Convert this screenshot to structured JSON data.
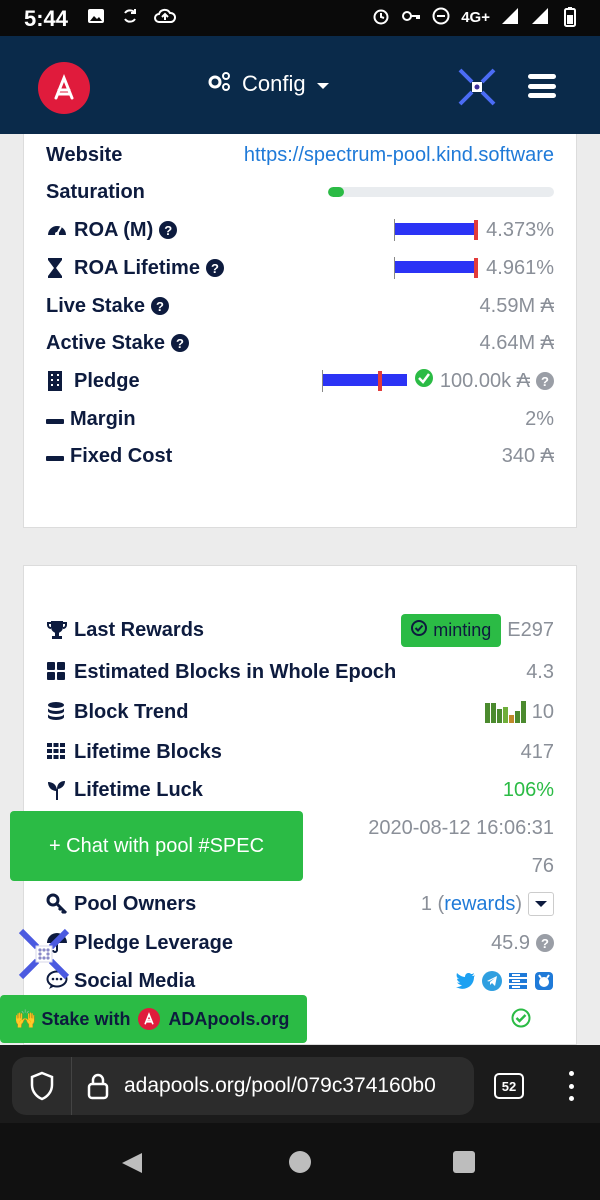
{
  "status_bar": {
    "time": "5:44",
    "network": "4G+"
  },
  "header": {
    "config_label": "Config"
  },
  "pool_params": {
    "website_label": "Website",
    "website_value": "https://spectrum-pool.kind.software",
    "saturation_label": "Saturation",
    "saturation_fraction": 0.07,
    "roa_m_label": "ROA (M)",
    "roa_m_value": "4.373%",
    "roa_lifetime_label": "ROA Lifetime",
    "roa_lifetime_value": "4.961%",
    "live_stake_label": "Live Stake",
    "live_stake_value": "4.59M ₳",
    "active_stake_label": "Active Stake",
    "active_stake_value": "4.64M ₳",
    "pledge_label": "Pledge",
    "pledge_value": "100.00k ₳",
    "margin_label": "Margin",
    "margin_value": "2%",
    "fixed_cost_label": "Fixed Cost",
    "fixed_cost_value": "340 ₳"
  },
  "pool_stats": {
    "last_rewards_label": "Last Rewards",
    "minting_badge": "minting",
    "last_rewards_epoch": "E297",
    "estimated_blocks_label": "Estimated Blocks in Whole Epoch",
    "estimated_blocks_value": "4.3",
    "block_trend_label": "Block Trend",
    "block_trend_value": "10",
    "lifetime_blocks_label": "Lifetime Blocks",
    "lifetime_blocks_value": "417",
    "lifetime_luck_label": "Lifetime Luck",
    "lifetime_luck_value": "106%",
    "registered_value": "2020-08-12 16:06:31",
    "hidden_row_value": "76",
    "pool_owners_label": "Pool Owners",
    "pool_owners_count": "1 (",
    "pool_owners_rewards": "rewards",
    "pool_owners_close": ")",
    "pledge_leverage_label": "Pledge Leverage",
    "pledge_leverage_value": "45.9",
    "social_media_label": "Social Media"
  },
  "floating": {
    "chat_button": "+ Chat with pool #SPEC",
    "stake_button_prefix": "🙌 Stake with",
    "stake_button_suffix": "ADApools.org"
  },
  "browser": {
    "url": "adapools.org/pool/079c374160b0",
    "tab_count": "52"
  },
  "colors": {
    "accent_green": "#2bbb45",
    "header_navy": "#0a2a4a",
    "brand_red": "#e01b3c",
    "link_blue": "#1f7ad8"
  }
}
